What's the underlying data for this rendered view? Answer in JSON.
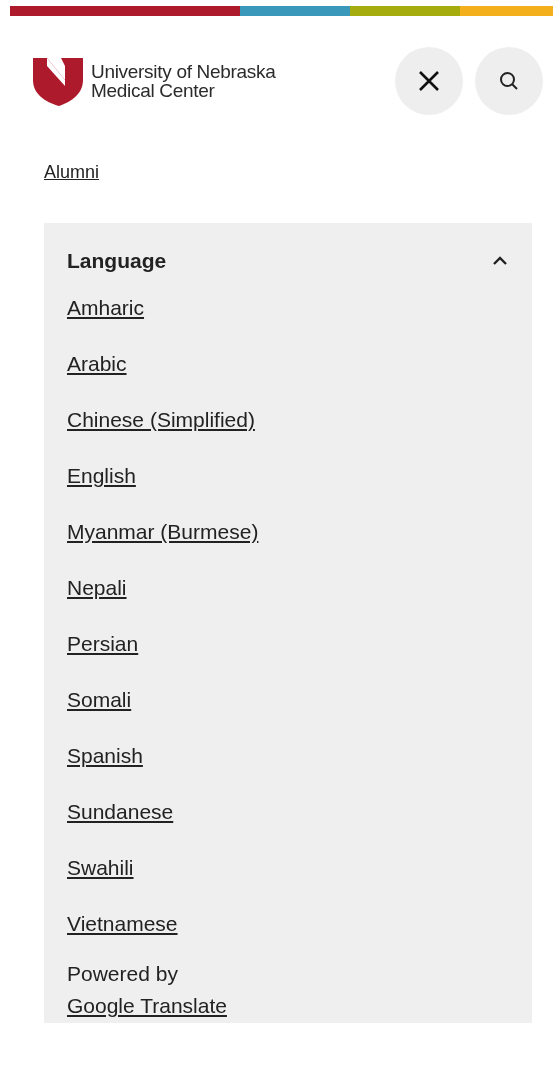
{
  "header": {
    "logo_lines": [
      "University of Nebraska",
      "Medical Center"
    ]
  },
  "breadcrumb": "Alumni",
  "language_panel": {
    "title": "Language",
    "expanded": true,
    "languages": [
      "Amharic",
      "Arabic",
      "Chinese (Simplified)",
      "English",
      "Myanmar (Burmese)",
      "Nepali",
      "Persian",
      "Somali",
      "Spanish",
      "Sundanese",
      "Swahili",
      "Vietnamese"
    ],
    "powered_by": "Powered by",
    "powered_link": "Google Translate"
  }
}
